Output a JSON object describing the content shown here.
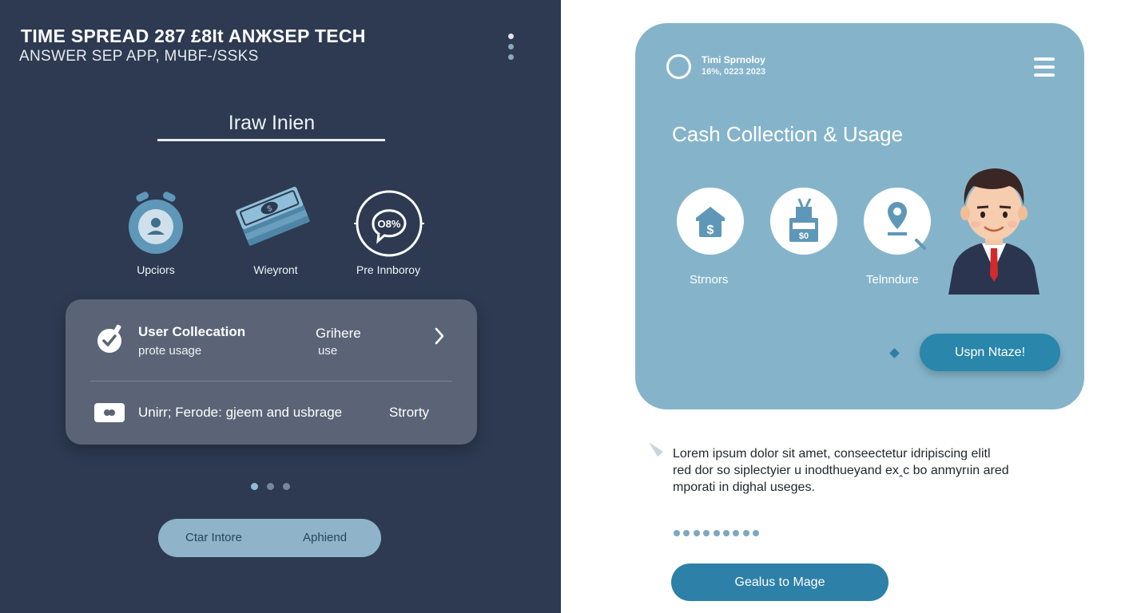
{
  "colors": {
    "left_bg": "#2d3a51",
    "card_bg": "#5a6476",
    "pill_bg": "#8fb3c8",
    "blue_card_bg": "#85b4ca",
    "accent_blue": "#2d80a7",
    "icon_blue": "#5f97b8",
    "text_dark": "#1f2630"
  },
  "header": {
    "title": "TIME SPREAD 287 £8It ANЖSEP TECH",
    "subtitle": "ANSWER SEP APP, MЧBF-/SSKS",
    "menu_icon": "kebab-menu-icon"
  },
  "section": {
    "heading": "Iraw Inien"
  },
  "features": [
    {
      "label": "Upciors",
      "icon": "alarm-clock-user-icon"
    },
    {
      "label": "Wieyront",
      "icon": "money-stack-icon"
    },
    {
      "label": "Pre Innboroy",
      "icon": "percent-chat-icon"
    }
  ],
  "card": {
    "row1": {
      "title": "User Collecation",
      "subtitle": "prote usage",
      "middle_title": "Grihere",
      "middle_sub": "use",
      "icon": "check-timer-icon",
      "chevron": "chevron-right-icon"
    },
    "row2": {
      "text": "Unirr; Ferode: gjeem and usbrage",
      "end": "Strorty",
      "icon": "ticket-icon"
    }
  },
  "carousel_left": {
    "count": 3,
    "active": 0
  },
  "pill": {
    "left": "Ctar Intore",
    "right": "Aphiend"
  },
  "blue_card": {
    "brand_name": "Timi Sprnoloy",
    "brand_date": "16%, 0223 2023",
    "title": "Cash Collection & Usage",
    "circles": [
      {
        "icon": "house-dollar-icon",
        "label": "Strnors"
      },
      {
        "icon": "cash-register-icon",
        "label": ""
      },
      {
        "icon": "location-search-icon",
        "label": "Telnndure"
      }
    ],
    "avatar_icon": "businessman-avatar-icon",
    "button_label": "Uspn Ntaze!"
  },
  "description": {
    "line1": "Lorem ipsum dolor sit amet, conseectetur idripiscing elitl",
    "line2": "red dor so siplectyier u inodthueyand exꞈc bo anmyrıin ared",
    "line3": "mporati in dighal useges."
  },
  "carousel_right": {
    "count": 9
  },
  "cta_label": "Gealus to Mage"
}
